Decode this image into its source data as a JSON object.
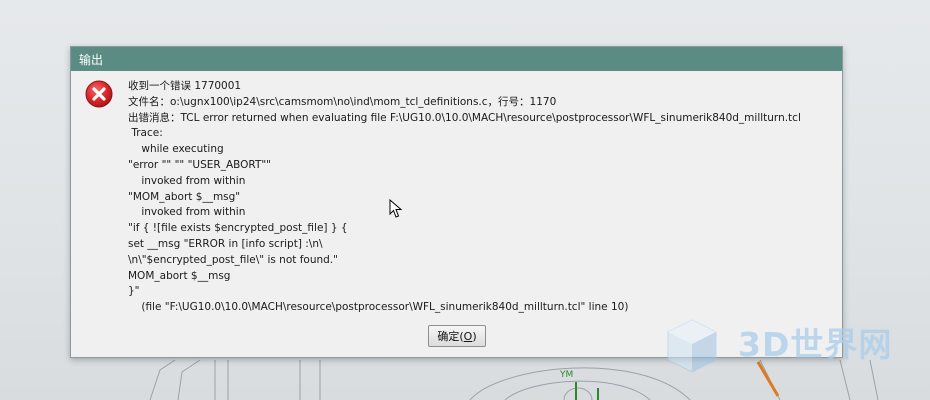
{
  "dialog": {
    "title": "输出",
    "message_lines": [
      "收到一个错误 1770001",
      "文件名：o:\\ugnx100\\ip24\\src\\camsmom\\no\\ind\\mom_tcl_definitions.c，行号：1170",
      "出错消息：TCL error returned when evaluating file F:\\UG10.0\\10.0\\MACH\\resource\\postprocessor\\WFL_sinumerik840d_millturn.tcl",
      " Trace:",
      "    while executing",
      "\"error \"\" \"\" \"USER_ABORT\"\"",
      "    invoked from within",
      "\"MOM_abort $__msg\"",
      "    invoked from within",
      "\"if { ![file exists $encrypted_post_file] } {",
      "set __msg \"ERROR in [info script] :\\n\\",
      "\\n\\\"$encrypted_post_file\\\" is not found.\"",
      "MOM_abort $__msg",
      "}\"",
      "    (file \"F:\\UG10.0\\10.0\\MACH\\resource\\postprocessor\\WFL_sinumerik840d_millturn.tcl\" line 10)"
    ],
    "ok_label_prefix": "确定(",
    "ok_label_key": "O",
    "ok_label_suffix": ")",
    "icon": "error-icon"
  },
  "background": {
    "axis_label": "YM",
    "icons": [
      "mouse-cursor-icon"
    ]
  },
  "watermark": {
    "text": "3D世界网"
  },
  "colors": {
    "titlebar": "#5a8c83",
    "dialog_bg": "#f0f0f0",
    "error_red": "#d9242a",
    "watermark": "#aacdeb"
  }
}
